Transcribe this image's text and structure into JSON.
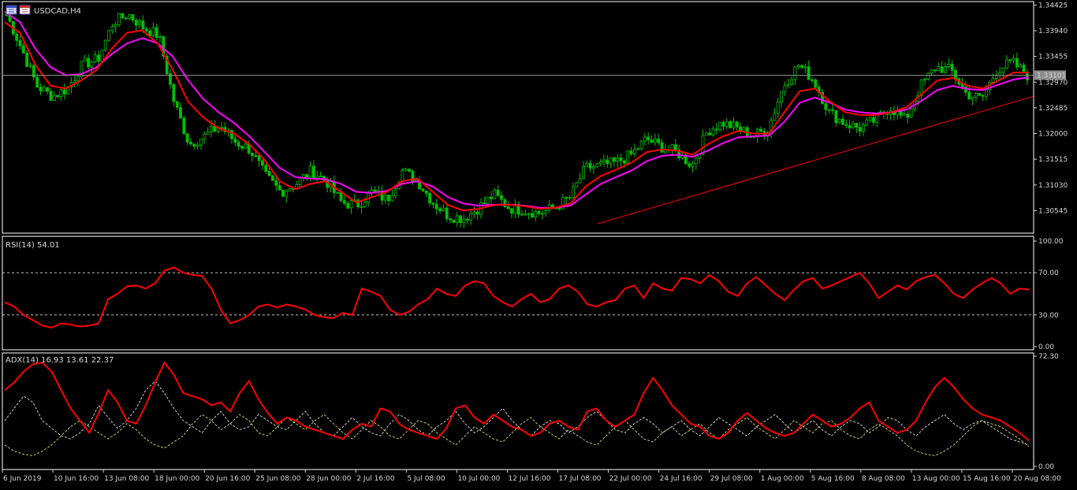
{
  "window": {
    "symbol_title": "USDCAD,H4",
    "icons": [
      "chart-window-icon",
      "chart-window-icon"
    ]
  },
  "price_panel": {
    "current_price": "1.33101",
    "y_ticks": [
      "1.34425",
      "1.33940",
      "1.33455",
      "1.32970",
      "1.32485",
      "1.32000",
      "1.31515",
      "1.31030",
      "1.30545"
    ],
    "ylim": [
      1.3015,
      1.3446
    ]
  },
  "rsi_panel": {
    "label": "RSI(14) 54.01",
    "y_ticks": [
      "100.00",
      "70.00",
      "30.00",
      "0.00"
    ],
    "levels": [
      70,
      30
    ]
  },
  "adx_panel": {
    "label": "ADX(14) 16.93 13.61 22.37",
    "y_ticks": [
      "72.30",
      "0.00"
    ]
  },
  "x_ticks": [
    "6 Jun 2019",
    "10 Jun 16:00",
    "13 Jun 08:00",
    "18 Jun 00:00",
    "20 Jun 16:00",
    "25 Jun 08:00",
    "28 Jun 00:00",
    "2 Jul 16:00",
    "5 Jul 08:00",
    "10 Jul 00:00",
    "12 Jul 16:00",
    "17 Jul 08:00",
    "22 Jul 00:00",
    "24 Jul 16:00",
    "29 Jul 08:00",
    "1 Aug 00:00",
    "5 Aug 16:00",
    "8 Aug 08:00",
    "13 Aug 00:00",
    "15 Aug 16:00",
    "20 Aug 08:00"
  ],
  "colors": {
    "background": "#000000",
    "border": "#ffffff",
    "bull_candle": "#00c000",
    "ma_fast": "#ff0000",
    "ma_slow": "#ff00ff",
    "trendline": "#ff0000",
    "price_line": "#8c8c8c",
    "rsi_line": "#ff0000",
    "adx_main": "#ff0000",
    "adx_plus_di": "#cccccc",
    "adx_minus_di": "#c8c864",
    "text": "#d6d6d6"
  },
  "chart_data": [
    {
      "type": "candlestick",
      "title": "USDCAD,H4",
      "ylim": [
        1.3015,
        1.3446
      ],
      "x": [
        "6 Jun 2019",
        "10 Jun 16:00",
        "13 Jun 08:00",
        "18 Jun 00:00",
        "20 Jun 16:00",
        "25 Jun 08:00",
        "28 Jun 00:00",
        "2 Jul 16:00",
        "5 Jul 08:00",
        "10 Jul 00:00",
        "12 Jul 16:00",
        "17 Jul 08:00",
        "22 Jul 00:00",
        "24 Jul 16:00",
        "29 Jul 08:00",
        "1 Aug 00:00",
        "5 Aug 16:00",
        "8 Aug 08:00",
        "13 Aug 00:00",
        "15 Aug 16:00",
        "20 Aug 08:00"
      ],
      "close_path": [
        1.3425,
        1.336,
        1.329,
        1.327,
        1.3285,
        1.333,
        1.334,
        1.341,
        1.3425,
        1.34,
        1.3385,
        1.326,
        1.318,
        1.3195,
        1.3215,
        1.3185,
        1.317,
        1.312,
        1.309,
        1.3105,
        1.313,
        1.311,
        1.307,
        1.3065,
        1.309,
        1.3075,
        1.313,
        1.311,
        1.307,
        1.3045,
        1.304,
        1.306,
        1.3085,
        1.306,
        1.3055,
        1.305,
        1.306,
        1.308,
        1.3135,
        1.314,
        1.3145,
        1.316,
        1.319,
        1.3175,
        1.3165,
        1.314,
        1.3205,
        1.322,
        1.321,
        1.3195,
        1.321,
        1.329,
        1.333,
        1.33,
        1.324,
        1.322,
        1.321,
        1.3225,
        1.325,
        1.3225,
        1.329,
        1.3325,
        1.332,
        1.3275,
        1.3265,
        1.332,
        1.3335,
        1.331
      ],
      "series": [
        {
          "name": "MA fast",
          "values": [
            1.341,
            1.339,
            1.333,
            1.329,
            1.3285,
            1.33,
            1.332,
            1.336,
            1.339,
            1.3395,
            1.337,
            1.332,
            1.326,
            1.323,
            1.321,
            1.32,
            1.318,
            1.315,
            1.311,
            1.3095,
            1.3105,
            1.311,
            1.309,
            1.307,
            1.308,
            1.309,
            1.311,
            1.3115,
            1.309,
            1.3065,
            1.3055,
            1.3058,
            1.3065,
            1.3066,
            1.3063,
            1.3058,
            1.306,
            1.3068,
            1.31,
            1.312,
            1.3132,
            1.3145,
            1.3165,
            1.317,
            1.3168,
            1.316,
            1.318,
            1.3195,
            1.3205,
            1.32,
            1.32,
            1.324,
            1.328,
            1.3285,
            1.326,
            1.324,
            1.3235,
            1.3235,
            1.324,
            1.325,
            1.3275,
            1.33,
            1.3305,
            1.329,
            1.3285,
            1.33,
            1.3315,
            1.3315
          ]
        },
        {
          "name": "MA slow",
          "values": [
            1.343,
            1.341,
            1.336,
            1.3325,
            1.331,
            1.3312,
            1.3325,
            1.335,
            1.337,
            1.338,
            1.337,
            1.3345,
            1.33,
            1.3265,
            1.324,
            1.322,
            1.3195,
            1.3165,
            1.3135,
            1.3118,
            1.3115,
            1.3114,
            1.3105,
            1.309,
            1.3088,
            1.3092,
            1.3105,
            1.311,
            1.31,
            1.308,
            1.3068,
            1.3064,
            1.3066,
            1.3066,
            1.3064,
            1.306,
            1.306,
            1.3064,
            1.3085,
            1.3105,
            1.3118,
            1.313,
            1.3148,
            1.3158,
            1.316,
            1.3156,
            1.3168,
            1.3182,
            1.3193,
            1.3195,
            1.3196,
            1.3222,
            1.3258,
            1.3268,
            1.3258,
            1.3245,
            1.324,
            1.3238,
            1.324,
            1.3245,
            1.3262,
            1.3282,
            1.329,
            1.3284,
            1.3282,
            1.3292,
            1.3302,
            1.3306
          ]
        }
      ],
      "horizontal_line": 1.33101,
      "trendline": {
        "from": [
          "17 Jul 08:00",
          1.303
        ],
        "to": [
          "20 Aug 08:00",
          1.327
        ]
      }
    },
    {
      "type": "line",
      "title": "RSI(14) 54.01",
      "ylim": [
        0,
        100
      ],
      "levels": [
        70,
        30
      ],
      "series": [
        {
          "name": "RSI(14)",
          "values": [
            42,
            38,
            30,
            25,
            20,
            18,
            22,
            21,
            19,
            20,
            22,
            45,
            50,
            57,
            58,
            55,
            60,
            72,
            75,
            70,
            68,
            67,
            55,
            35,
            22,
            25,
            30,
            38,
            40,
            37,
            40,
            38,
            35,
            30,
            28,
            27,
            32,
            30,
            55,
            52,
            48,
            35,
            30,
            33,
            40,
            45,
            55,
            50,
            48,
            58,
            62,
            60,
            48,
            42,
            38,
            45,
            50,
            42,
            45,
            55,
            58,
            52,
            40,
            38,
            42,
            44,
            55,
            58,
            46,
            60,
            55,
            53,
            65,
            64,
            60,
            68,
            62,
            52,
            48,
            60,
            66,
            58,
            50,
            44,
            54,
            62,
            65,
            55,
            58,
            62,
            66,
            70,
            60,
            46,
            52,
            58,
            54,
            62,
            66,
            68,
            60,
            50,
            46,
            54,
            60,
            65,
            60,
            50,
            55,
            54
          ]
        }
      ]
    },
    {
      "type": "line",
      "title": "ADX(14) 16.93 13.61 22.37",
      "ylim": [
        0,
        72.3
      ],
      "series": [
        {
          "name": "ADX(14)",
          "values": [
            50,
            55,
            62,
            67,
            68,
            62,
            50,
            38,
            30,
            22,
            35,
            50,
            42,
            30,
            28,
            40,
            55,
            68,
            60,
            48,
            46,
            44,
            40,
            42,
            36,
            48,
            56,
            44,
            35,
            28,
            32,
            30,
            26,
            24,
            22,
            20,
            18,
            24,
            28,
            26,
            38,
            36,
            28,
            24,
            22,
            20,
            18,
            25,
            38,
            40,
            32,
            28,
            34,
            30,
            26,
            24,
            20,
            22,
            28,
            30,
            26,
            24,
            36,
            38,
            30,
            26,
            30,
            34,
            48,
            58,
            50,
            40,
            34,
            28,
            26,
            20,
            18,
            22,
            30,
            35,
            30,
            25,
            22,
            20,
            22,
            28,
            34,
            30,
            26,
            28,
            32,
            38,
            42,
            30,
            26,
            22,
            24,
            30,
            42,
            52,
            58,
            52,
            44,
            38,
            34,
            32,
            30,
            26,
            22,
            17
          ]
        },
        {
          "name": "+DI",
          "values": [
            30,
            38,
            46,
            42,
            30,
            25,
            20,
            18,
            22,
            28,
            40,
            32,
            25,
            30,
            38,
            50,
            56,
            48,
            38,
            30,
            26,
            22,
            30,
            36,
            28,
            24,
            26,
            34,
            30,
            26,
            24,
            30,
            36,
            28,
            22,
            20,
            26,
            32,
            26,
            22,
            20,
            28,
            34,
            30,
            24,
            20,
            26,
            30,
            36,
            28,
            22,
            26,
            32,
            38,
            30,
            24,
            20,
            26,
            30,
            28,
            22,
            26,
            32,
            36,
            30,
            24,
            22,
            28,
            32,
            28,
            22,
            26,
            30,
            24,
            20,
            26,
            32,
            28,
            24,
            20,
            26,
            30,
            34,
            28,
            22,
            26,
            30,
            24,
            20,
            26,
            30,
            28,
            22,
            26,
            32,
            30,
            24,
            20,
            26,
            30,
            34,
            28,
            24,
            28,
            30,
            26,
            22,
            18,
            16,
            14
          ]
        },
        {
          "name": "-DI",
          "values": [
            14,
            10,
            8,
            7,
            10,
            14,
            20,
            26,
            30,
            26,
            22,
            18,
            22,
            28,
            24,
            18,
            14,
            12,
            16,
            20,
            28,
            34,
            30,
            24,
            28,
            34,
            30,
            22,
            20,
            26,
            32,
            28,
            24,
            30,
            34,
            28,
            22,
            18,
            24,
            30,
            26,
            20,
            18,
            24,
            30,
            28,
            22,
            18,
            14,
            20,
            26,
            22,
            18,
            16,
            22,
            28,
            32,
            26,
            22,
            18,
            24,
            20,
            16,
            14,
            20,
            26,
            30,
            24,
            18,
            16,
            22,
            26,
            20,
            24,
            28,
            22,
            18,
            24,
            28,
            32,
            26,
            22,
            18,
            24,
            30,
            26,
            22,
            28,
            30,
            24,
            20,
            18,
            24,
            28,
            24,
            20,
            14,
            10,
            8,
            7,
            10,
            14,
            20,
            26,
            30,
            28,
            26,
            22,
            18,
            13
          ]
        }
      ]
    }
  ]
}
